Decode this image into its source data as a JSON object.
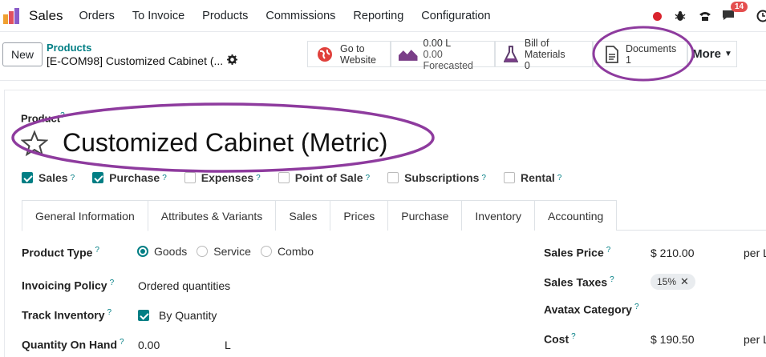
{
  "app": {
    "name": "Sales"
  },
  "nav": {
    "items": [
      "Orders",
      "To Invoice",
      "Products",
      "Commissions",
      "Reporting",
      "Configuration"
    ],
    "chat_count": "14"
  },
  "control_panel": {
    "new_label": "New",
    "breadcrumb_parent": "Products",
    "breadcrumb_current": "[E-COM98] Customized Cabinet (...",
    "smart_buttons": {
      "website": {
        "line1": "Go to",
        "line2": "Website"
      },
      "stock": {
        "line1": "0.00 L",
        "line2": "0.00 Forecasted"
      },
      "bom": {
        "line1": "Bill of Materials",
        "line2": "0"
      },
      "documents": {
        "line1": "Documents",
        "line2": "1"
      },
      "more": "More"
    }
  },
  "form": {
    "product_label": "Product",
    "product_name": "Customized Cabinet (Metric)",
    "options": [
      {
        "label": "Sales",
        "checked": true
      },
      {
        "label": "Purchase",
        "checked": true
      },
      {
        "label": "Expenses",
        "checked": false
      },
      {
        "label": "Point of Sale",
        "checked": false
      },
      {
        "label": "Subscriptions",
        "checked": false
      },
      {
        "label": "Rental",
        "checked": false
      }
    ],
    "tabs": [
      "General Information",
      "Attributes & Variants",
      "Sales",
      "Prices",
      "Purchase",
      "Inventory",
      "Accounting"
    ],
    "product_type": {
      "label": "Product Type",
      "options": [
        "Goods",
        "Service",
        "Combo"
      ],
      "selected": "Goods"
    },
    "invoicing_policy": {
      "label": "Invoicing Policy",
      "value": "Ordered quantities"
    },
    "track_inventory": {
      "label": "Track Inventory",
      "value": "By Quantity"
    },
    "quantity_on_hand": {
      "label": "Quantity On Hand",
      "value": "0.00",
      "unit": "L"
    },
    "sales_price": {
      "label": "Sales Price",
      "value": "$ 210.00",
      "per": "per L"
    },
    "sales_taxes": {
      "label": "Sales Taxes",
      "value": "15%"
    },
    "avatax_category": {
      "label": "Avatax Category"
    },
    "cost": {
      "label": "Cost",
      "value": "$ 190.50",
      "per": "per L"
    }
  },
  "colors": {
    "accent": "#017e84",
    "annotation": "#8e3b9e",
    "badge": "#e44e4e"
  }
}
